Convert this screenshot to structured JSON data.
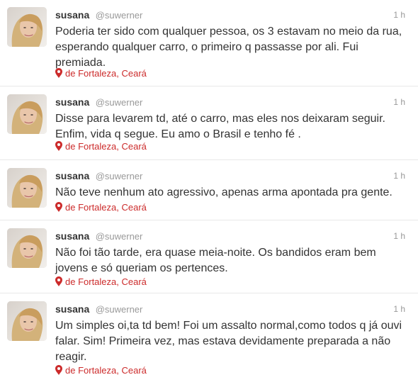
{
  "tweets": [
    {
      "name": "susana",
      "handle": "@suwerner",
      "time": "1 h",
      "text": "Poderia ter sido com qualquer pessoa, os 3 estavam no meio da rua, esperando qualquer carro,  o primeiro q passasse por ali. Fui premiada.",
      "location": "de Fortaleza, Ceará",
      "avatar_icon": "profile-photo"
    },
    {
      "name": "susana",
      "handle": "@suwerner",
      "time": "1 h",
      "text": "Disse para levarem td, até o carro, mas eles nos deixaram seguir. Enfim, vida q segue. Eu amo o Brasil e tenho fé .",
      "location": "de Fortaleza, Ceará",
      "avatar_icon": "profile-photo"
    },
    {
      "name": "susana",
      "handle": "@suwerner",
      "time": "1 h",
      "text": "Não teve nenhum ato agressivo, apenas arma apontada pra gente.",
      "location": "de Fortaleza, Ceará",
      "avatar_icon": "profile-photo"
    },
    {
      "name": "susana",
      "handle": "@suwerner",
      "time": "1 h",
      "text": "Não foi tão tarde, era quase meia-noite. Os bandidos eram bem jovens e só queriam os pertences.",
      "location": "de Fortaleza, Ceará",
      "avatar_icon": "profile-photo"
    },
    {
      "name": "susana",
      "handle": "@suwerner",
      "time": "1 h",
      "text": "Um simples oi,ta td bem! Foi um assalto normal,como todos q já ouvi falar. Sim! Primeira vez, mas estava devidamente preparada a não reagir.",
      "location": "de Fortaleza, Ceará",
      "avatar_icon": "profile-photo"
    }
  ],
  "colors": {
    "name": "#333333",
    "handle": "#999999",
    "time": "#999999",
    "location": "#cc2b2b",
    "divider": "#e8e8e8"
  },
  "icons": {
    "location": "map-pin-icon"
  }
}
